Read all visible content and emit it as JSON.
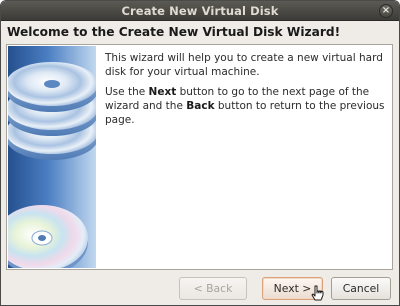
{
  "window": {
    "title": "Create New Virtual Disk",
    "close_icon": "close-icon"
  },
  "header": {
    "heading": "Welcome to the Create New Virtual Disk Wizard!"
  },
  "body": {
    "intro": "This wizard will help you to create a new virtual hard disk for your virtual machine.",
    "nav_prefix": "Use the ",
    "nav_next": "Next",
    "nav_middle": " button to go to the next page of the wizard and the ",
    "nav_back": "Back",
    "nav_suffix": " button to return to the previous page.",
    "side_image_icon": "disk-stack-icon"
  },
  "buttons": {
    "back": "< Back",
    "next": "Next >",
    "cancel": "Cancel"
  },
  "colors": {
    "panel_blue": "#3b6db0",
    "focus_border": "#d8a37b",
    "titlebar": "#3c3b37"
  }
}
